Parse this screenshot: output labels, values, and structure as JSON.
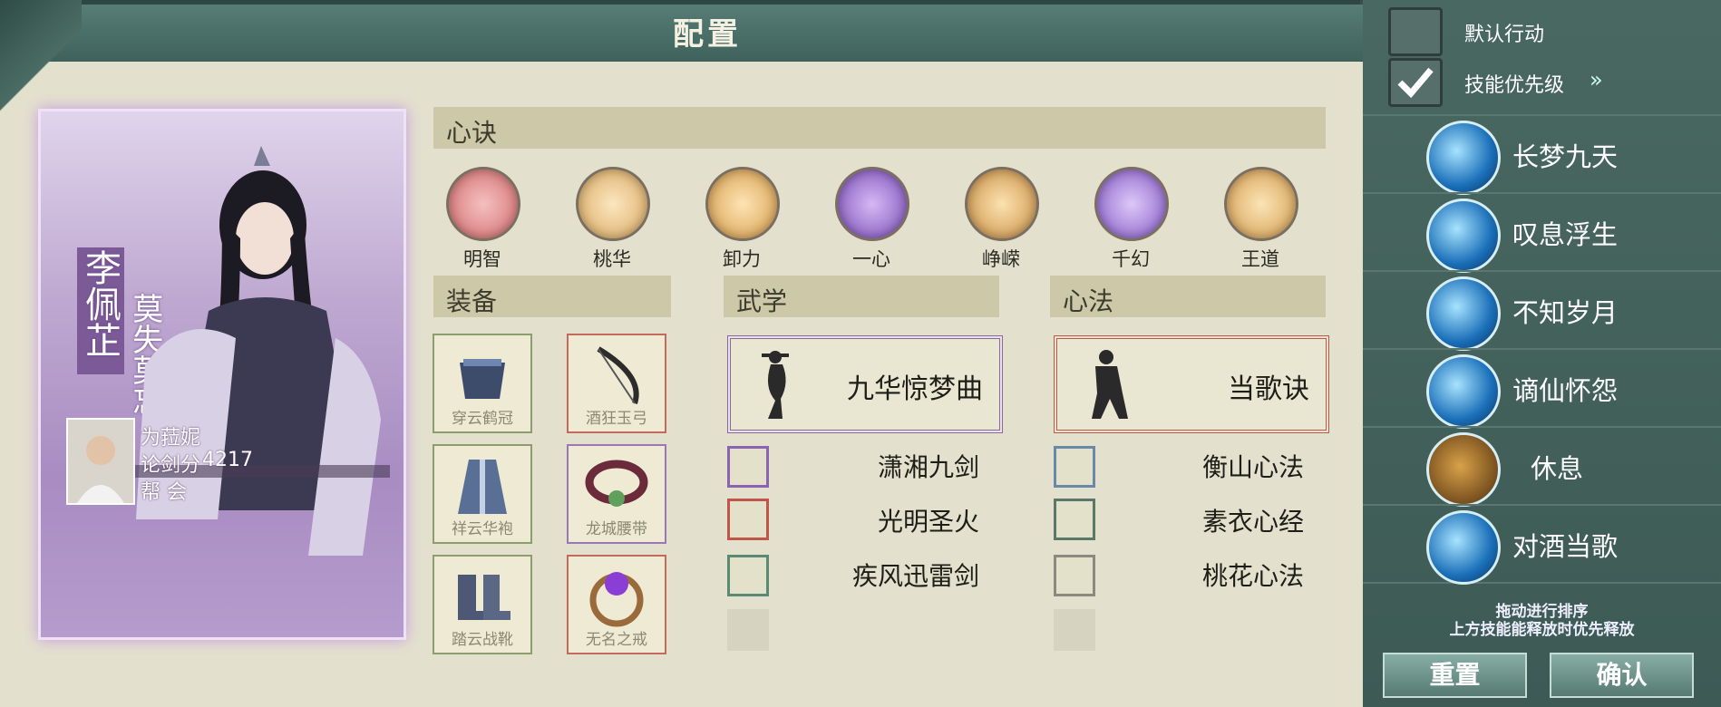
{
  "title": "配置",
  "character": {
    "name": "李佩芷",
    "motto": "莫失莫忘",
    "player_name": "为菈妮",
    "score_label": "论剑分",
    "score": "4217",
    "guild_label": "帮  会"
  },
  "sections": {
    "xinjue": "心诀",
    "equipment": "装备",
    "wuxue": "武学",
    "xinfa": "心法"
  },
  "xinjue": [
    {
      "label": "明智",
      "color": "#e58a8a"
    },
    {
      "label": "桃华",
      "color": "#e8c48a"
    },
    {
      "label": "卸力",
      "color": "#e8bf74"
    },
    {
      "label": "一心",
      "color": "#9b6bd0"
    },
    {
      "label": "峥嵘",
      "color": "#e3b46c"
    },
    {
      "label": "千幻",
      "color": "#a07bd8"
    },
    {
      "label": "王道",
      "color": "#e9bd73"
    }
  ],
  "equipment": [
    {
      "label": "穿云鹤冠"
    },
    {
      "label": "酒狂玉弓"
    },
    {
      "label": "祥云华袍"
    },
    {
      "label": "龙城腰带"
    },
    {
      "label": "踏云战靴"
    },
    {
      "label": "无名之戒"
    }
  ],
  "wuxue": {
    "main": "九华惊梦曲",
    "items": [
      "潇湘九剑",
      "光明圣火",
      "疾风迅雷剑"
    ]
  },
  "xinfa": {
    "main": "当歌诀",
    "items": [
      "衡山心法",
      "素衣心经",
      "桃花心法"
    ]
  },
  "panel": {
    "default_action": "默认行动",
    "skill_priority": "技能优先级",
    "skills": [
      "长梦九天",
      "叹息浮生",
      "不知岁月",
      "谪仙怀怨",
      "休息",
      "对酒当歌"
    ],
    "hint_line1": "拖动进行排序",
    "hint_line2": "上方技能能释放时优先释放",
    "reset": "重置",
    "confirm": "确认"
  }
}
